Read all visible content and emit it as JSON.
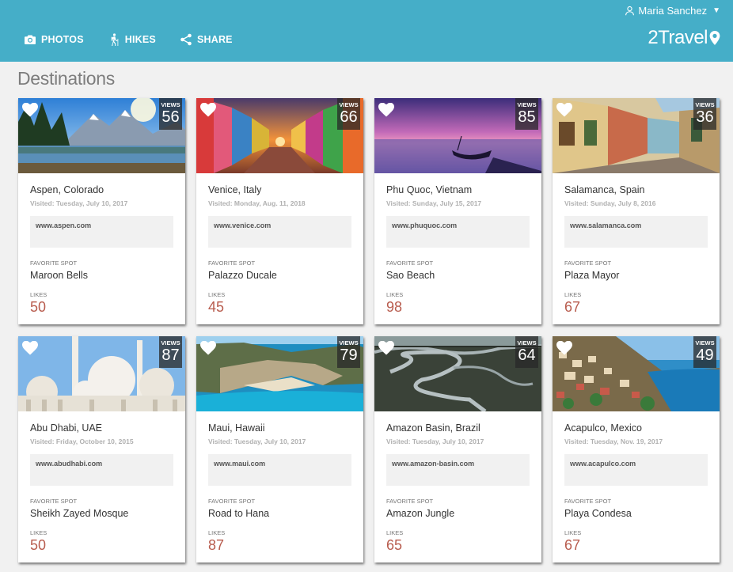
{
  "user": {
    "name": "Maria Sanchez",
    "caret": "▼"
  },
  "nav": [
    {
      "label": "PHOTOS",
      "icon": "camera-icon"
    },
    {
      "label": "HIKES",
      "icon": "hiker-icon"
    },
    {
      "label": "SHARE",
      "icon": "share-icon"
    }
  ],
  "brand": {
    "name": "2Travel",
    "icon": "map-pin-icon"
  },
  "page": {
    "title": "Destinations"
  },
  "labels": {
    "views": "VIEWS",
    "favorite": "FAVORITE SPOT",
    "likes": "LIKES"
  },
  "colors": {
    "header": "#45aec8",
    "likes": "#b85c4e"
  },
  "cards": [
    {
      "place": "Aspen, Colorado",
      "visited": "Visited: Tuesday, July 10, 2017",
      "url": "www.aspen.com",
      "favorite": "Maroon Bells",
      "likes": "50",
      "views": "56"
    },
    {
      "place": "Venice, Italy",
      "visited": "Visited: Monday, Aug. 11, 2018",
      "url": "www.venice.com",
      "favorite": "Palazzo Ducale",
      "likes": "45",
      "views": "66"
    },
    {
      "place": "Phu Quoc, Vietnam",
      "visited": "Visited: Sunday, July 15, 2017",
      "url": "www.phuquoc.com",
      "favorite": "Sao Beach",
      "likes": "98",
      "views": "85"
    },
    {
      "place": "Salamanca, Spain",
      "visited": "Visited: Sunday, July 8, 2016",
      "url": "www.salamanca.com",
      "favorite": "Plaza Mayor",
      "likes": "67",
      "views": "36"
    },
    {
      "place": "Abu Dhabi, UAE",
      "visited": "Visited: Friday, October 10, 2015",
      "url": "www.abudhabi.com",
      "favorite": "Sheikh Zayed Mosque",
      "likes": "50",
      "views": "87"
    },
    {
      "place": "Maui, Hawaii",
      "visited": "Visited: Tuesday, July 10, 2017",
      "url": "www.maui.com",
      "favorite": "Road to Hana",
      "likes": "87",
      "views": "79"
    },
    {
      "place": "Amazon Basin, Brazil",
      "visited": "Visited: Tuesday, July 10, 2017",
      "url": "www.amazon-basin.com",
      "favorite": "Amazon Jungle",
      "likes": "65",
      "views": "64"
    },
    {
      "place": "Acapulco, Mexico",
      "visited": "Visited: Tuesday, Nov. 19, 2017",
      "url": "www.acapulco.com",
      "favorite": "Playa Condesa",
      "likes": "67",
      "views": "49"
    }
  ]
}
